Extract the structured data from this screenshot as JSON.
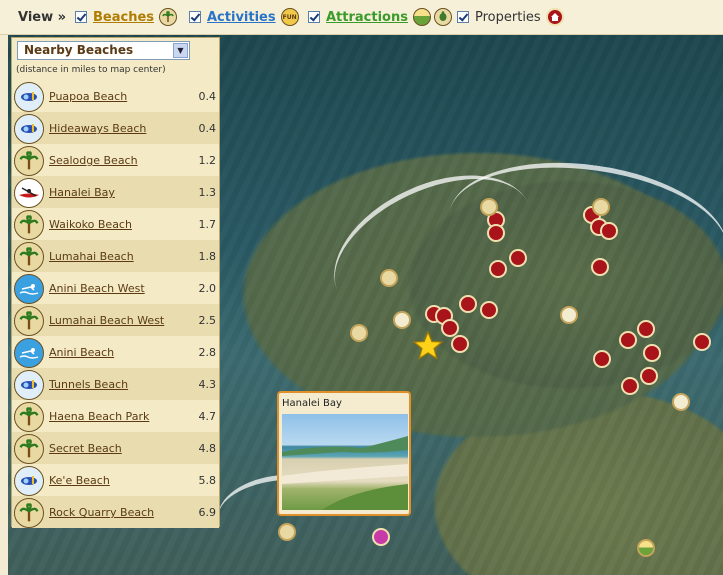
{
  "topbar": {
    "view_label": "View »",
    "filters": [
      {
        "label": "Beaches",
        "checked": true,
        "color": "#b07b00",
        "icons": [
          "palm-tree-icon"
        ]
      },
      {
        "label": "Activities",
        "checked": true,
        "color": "#2a74c8",
        "icons": [
          "fun-icon"
        ]
      },
      {
        "label": "Attractions",
        "checked": true,
        "color": "#3a9a2a",
        "icons": [
          "landscape-icon",
          "turtle-icon"
        ]
      },
      {
        "label": "Properties",
        "checked": true,
        "color": "#333333",
        "icons": [
          "house-icon"
        ]
      }
    ],
    "fun_badge_text": "FUN"
  },
  "panel": {
    "dropdown_value": "Nearby Beaches",
    "note": "(distance in miles to map center)",
    "beaches": [
      {
        "name": "Puapoa Beach",
        "distance": "0.4",
        "icon": "snorkel-icon"
      },
      {
        "name": "Hideaways Beach",
        "distance": "0.4",
        "icon": "snorkel-icon"
      },
      {
        "name": "Sealodge Beach",
        "distance": "1.2",
        "icon": "palm-tree-icon"
      },
      {
        "name": "Hanalei Bay",
        "distance": "1.3",
        "icon": "kayak-icon"
      },
      {
        "name": "Waikoko Beach",
        "distance": "1.7",
        "icon": "palm-tree-icon"
      },
      {
        "name": "Lumahai Beach",
        "distance": "1.8",
        "icon": "palm-tree-icon"
      },
      {
        "name": "Anini Beach West",
        "distance": "2.0",
        "icon": "swimmer-icon"
      },
      {
        "name": "Lumahai Beach West",
        "distance": "2.5",
        "icon": "palm-tree-icon"
      },
      {
        "name": "Anini Beach",
        "distance": "2.8",
        "icon": "swimmer-icon"
      },
      {
        "name": "Tunnels Beach",
        "distance": "4.3",
        "icon": "snorkel-icon"
      },
      {
        "name": "Haena Beach Park",
        "distance": "4.7",
        "icon": "palm-tree-icon"
      },
      {
        "name": "Secret Beach",
        "distance": "4.8",
        "icon": "palm-tree-icon"
      },
      {
        "name": "Ke'e Beach",
        "distance": "5.8",
        "icon": "snorkel-icon"
      },
      {
        "name": "Rock Quarry Beach",
        "distance": "6.9",
        "icon": "palm-tree-icon"
      }
    ]
  },
  "popup": {
    "title": "Hanalei Bay"
  }
}
